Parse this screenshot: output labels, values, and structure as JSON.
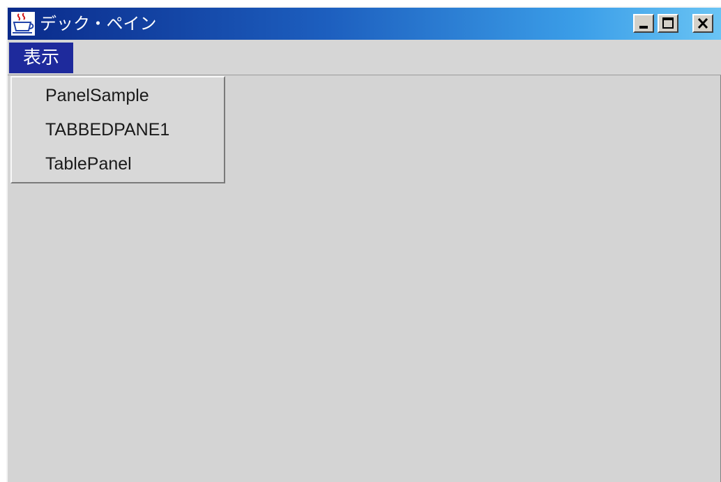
{
  "window": {
    "title": "デック・ペイン",
    "app_icon": "java-coffee-cup-icon",
    "controls": [
      "minimize-icon",
      "maximize-icon",
      "close-icon"
    ]
  },
  "menubar": {
    "display_menu_label": "表示"
  },
  "popup_menu": {
    "items": [
      "PanelSample",
      "TABBEDPANE1",
      "TablePanel"
    ]
  },
  "colors": {
    "titlebar_start": "#0a2a8a",
    "titlebar_end": "#6ac4f4",
    "menu_highlight": "#1e2a9c",
    "window_bg": "#d4d4d4"
  }
}
